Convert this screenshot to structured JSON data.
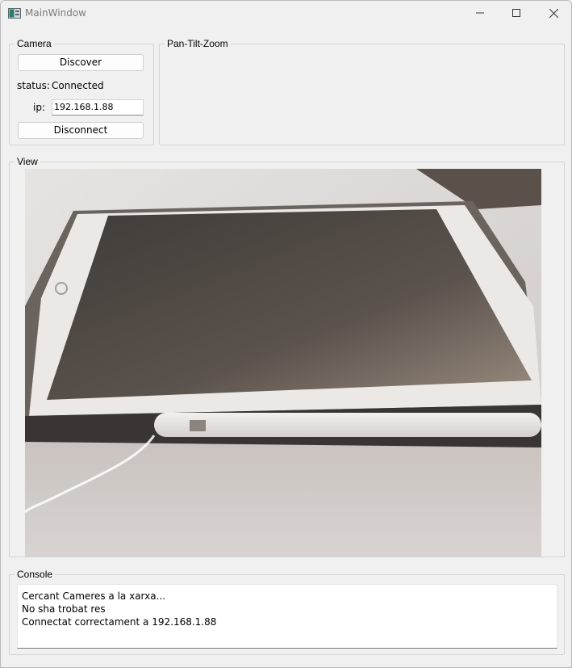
{
  "window": {
    "title": "MainWindow"
  },
  "camera": {
    "legend": "Camera",
    "discover_label": "Discover",
    "status_label": "status:",
    "status_value": "Connected",
    "ip_label": "ip:",
    "ip_value": "192.168.1.88",
    "disconnect_label": "Disconnect"
  },
  "ptz": {
    "legend": "Pan-Tilt-Zoom"
  },
  "view": {
    "legend": "View"
  },
  "console": {
    "legend": "Console",
    "lines": [
      "Cercant Cameres a la xarxa...",
      "No sha trobat res",
      "Connectat correctament a 192.168.1.88"
    ]
  },
  "icons": {
    "app": "app-window-icon",
    "minimize": "minimize-icon",
    "maximize": "maximize-icon",
    "close": "close-icon"
  }
}
